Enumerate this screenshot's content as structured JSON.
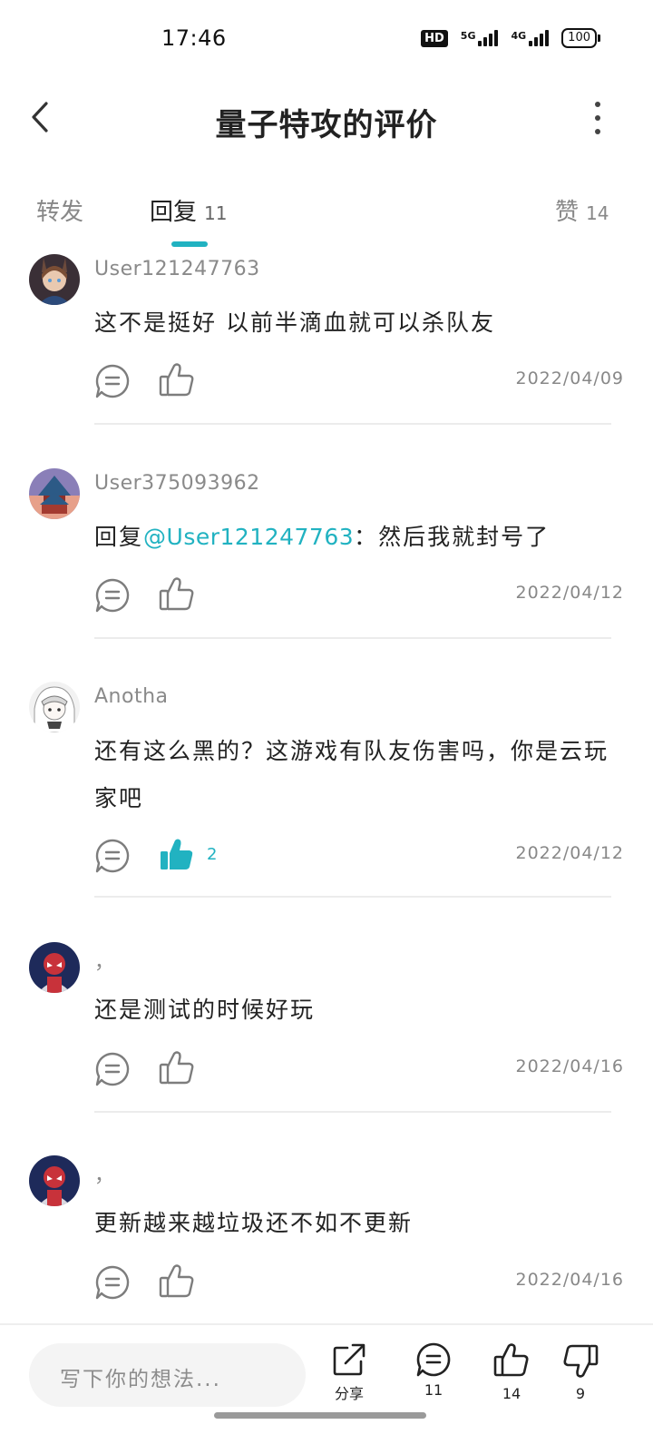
{
  "status": {
    "time": "17:46",
    "hd_label": "HD",
    "net1": "5G",
    "net2": "4G",
    "battery": "100"
  },
  "header": {
    "title": "量子特攻的评价",
    "back_icon": "chevron-left-icon",
    "more_icon": "more-vertical-icon"
  },
  "tabs": {
    "forward": {
      "label": "转发"
    },
    "reply": {
      "label": "回复",
      "count": "11",
      "active": true
    },
    "like": {
      "label": "赞",
      "count": "14"
    }
  },
  "comments": [
    {
      "user": "User121247763",
      "text": "这不是挺好 以前半滴血就可以杀队友",
      "date": "2022/04/09",
      "liked": false,
      "likes": ""
    },
    {
      "user": "User375093962",
      "reply_prefix": "回复",
      "mention": "@User121247763",
      "reply_text": "：然后我就封号了",
      "date": "2022/04/12",
      "liked": false,
      "likes": ""
    },
    {
      "user": "Anotha",
      "text": "还有这么黑的？这游戏有队友伤害吗，你是云玩家吧",
      "date": "2022/04/12",
      "liked": true,
      "likes": "2"
    },
    {
      "user": "，",
      "text": "还是测试的时候好玩",
      "date": "2022/04/16",
      "liked": false,
      "likes": ""
    },
    {
      "user": "，",
      "text": "更新越来越垃圾还不如不更新",
      "date": "2022/04/16",
      "liked": false,
      "likes": ""
    }
  ],
  "bottom_bar": {
    "input_placeholder": "写下你的想法...",
    "share_label": "分享",
    "comment_count": "11",
    "like_count": "14",
    "dislike_count": "9"
  },
  "colors": {
    "accent": "#21b2c1",
    "muted": "#888888"
  }
}
